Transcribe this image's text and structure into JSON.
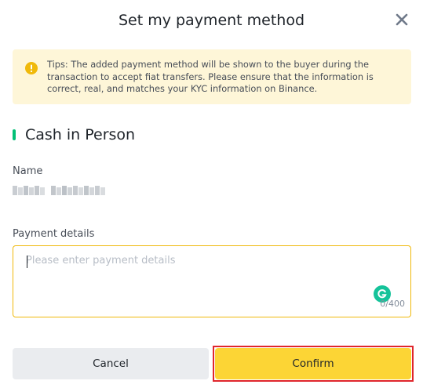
{
  "dialog": {
    "title": "Set my payment method",
    "close_icon": "close-icon"
  },
  "tips": {
    "icon": "warning-circle-icon",
    "text": "Tips: The added payment method will be shown to the buyer during the transaction to accept fiat transfers. Please ensure that the information is correct, real, and matches your KYC information on Binance."
  },
  "section": {
    "title": "Cash in Person",
    "marker_color": "#02c076"
  },
  "name_field": {
    "label": "Name",
    "value_blurred": true
  },
  "payment_details": {
    "label": "Payment details",
    "value": "",
    "placeholder": "Please enter payment details",
    "char_count": "0/400",
    "border_color": "#f0b90b"
  },
  "buttons": {
    "cancel_label": "Cancel",
    "confirm_label": "Confirm",
    "confirm_color": "#fcd535",
    "highlight_color": "#e0262c"
  },
  "grammarly": {
    "icon": "grammarly-icon",
    "color": "#15c39a"
  }
}
